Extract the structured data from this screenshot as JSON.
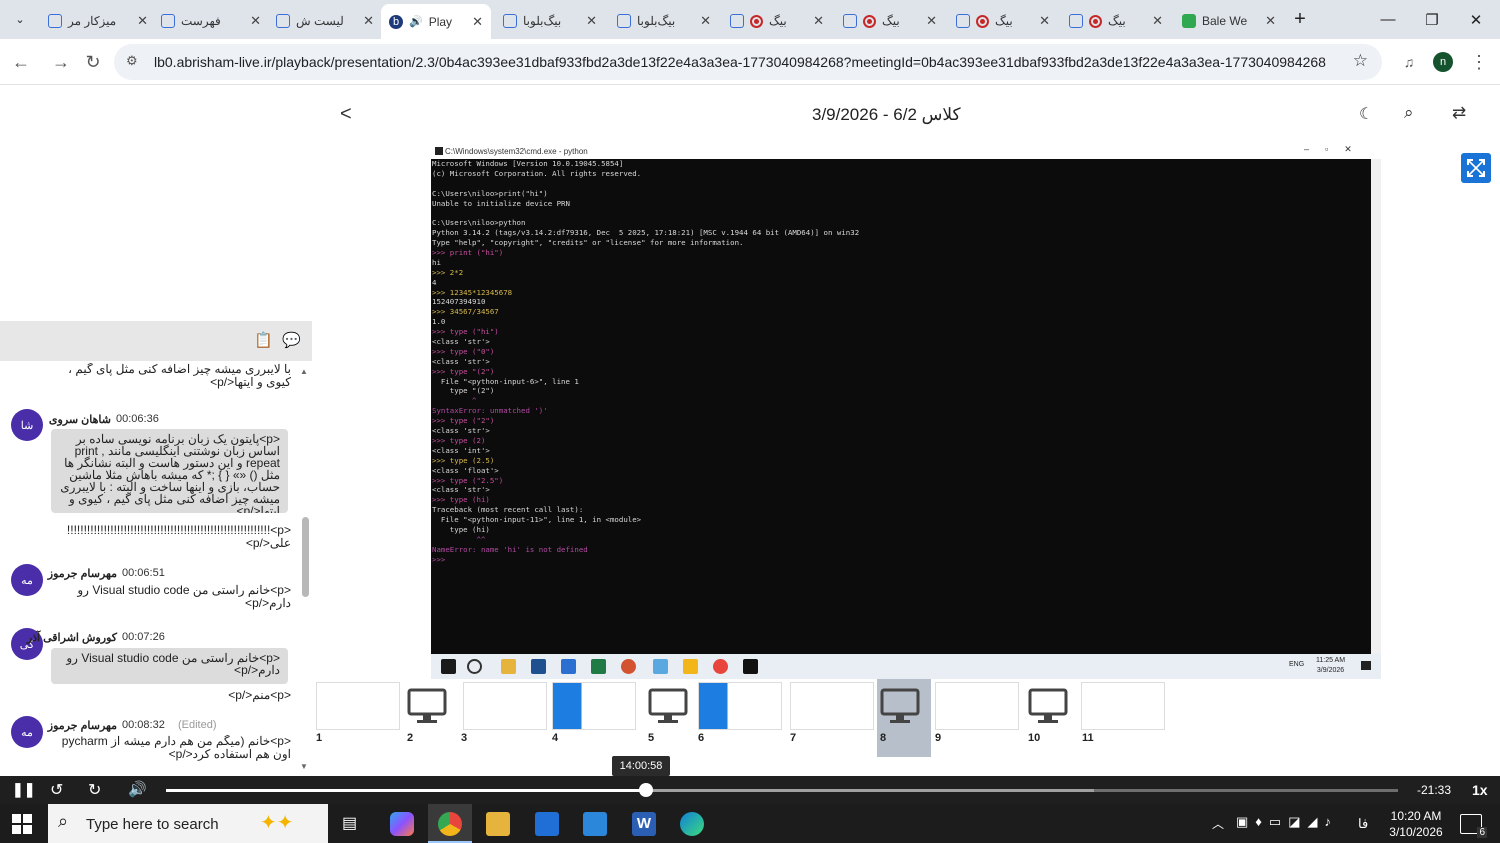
{
  "browser": {
    "tabs": [
      {
        "label": "میزکار مر",
        "icon": "bale-icon"
      },
      {
        "label": "فهرست",
        "icon": "bale-icon"
      },
      {
        "label": "لیست ش",
        "icon": "bale-icon"
      },
      {
        "label": "Play",
        "icon": "bigbluebutton-icon",
        "active": true
      },
      {
        "label": "بیگ‌بلوبا",
        "icon": "bale-icon"
      },
      {
        "label": "بیگ‌بلوبا",
        "icon": "bale-icon"
      },
      {
        "label": "بیگ",
        "icon": "bale-icon"
      },
      {
        "label": "بیگ",
        "icon": "bale-icon"
      },
      {
        "label": "بیگ",
        "icon": "bale-icon"
      },
      {
        "label": "بیگ",
        "icon": "bale-icon"
      },
      {
        "label": "Bale We",
        "icon": "bale-shield-icon"
      }
    ],
    "new_tab": "+",
    "url": "lb0.abrisham-live.ir/playback/presentation/2.3/0b4ac393ee31dbaf933fbd2a3de13f22e4a3a3ea-1773040984268?meetingId=0b4ac393ee31dbaf933fbd2a3de13f22e4a3a3ea-1773040984268",
    "profile_initial": "n"
  },
  "player": {
    "title": "کلاس 6/2 - 3/9/2026",
    "back": "<",
    "cmd_window_title": "C:\\Windows\\system32\\cmd.exe - python",
    "cmd_lines": [
      {
        "t": "Microsoft Windows [Version 10.0.19045.5854]",
        "c": ""
      },
      {
        "t": "(c) Microsoft Corporation. All rights reserved.",
        "c": ""
      },
      {
        "t": "",
        "c": ""
      },
      {
        "t": "C:\\Users\\niloo>print(\"hi\")",
        "c": ""
      },
      {
        "t": "Unable to initialize device PRN",
        "c": ""
      },
      {
        "t": "",
        "c": ""
      },
      {
        "t": "C:\\Users\\niloo>python",
        "c": ""
      },
      {
        "t": "Python 3.14.2 (tags/v3.14.2:df79316, Dec  5 2025, 17:18:21) [MSC v.1944 64 bit (AMD64)] on win32",
        "c": ""
      },
      {
        "t": "Type \"help\", \"copyright\", \"credits\" or \"license\" for more information.",
        "c": ""
      },
      {
        "t": ">>> print (\"hi\")",
        "c": "p"
      },
      {
        "t": "hi",
        "c": ""
      },
      {
        "t": ">>> 2*2",
        "c": "y"
      },
      {
        "t": "4",
        "c": ""
      },
      {
        "t": ">>> 12345*12345678",
        "c": "y"
      },
      {
        "t": "152407394910",
        "c": ""
      },
      {
        "t": ">>> 34567/34567",
        "c": "y"
      },
      {
        "t": "1.0",
        "c": ""
      },
      {
        "t": ">>> type (\"hi\")",
        "c": "p"
      },
      {
        "t": "<class 'str'>",
        "c": ""
      },
      {
        "t": ">>> type (\"0\")",
        "c": "p"
      },
      {
        "t": "<class 'str'>",
        "c": ""
      },
      {
        "t": ">>> type \"(2\")",
        "c": "p"
      },
      {
        "t": "  File \"<python-input-6>\", line 1",
        "c": ""
      },
      {
        "t": "    type \"(2\")",
        "c": ""
      },
      {
        "t": "         ^",
        "c": "e"
      },
      {
        "t": "SyntaxError: unmatched ')'",
        "c": "e"
      },
      {
        "t": ">>> type (\"2\")",
        "c": "p"
      },
      {
        "t": "<class 'str'>",
        "c": ""
      },
      {
        "t": ">>> type (2)",
        "c": "p"
      },
      {
        "t": "<class 'int'>",
        "c": ""
      },
      {
        "t": ">>> type (2.5)",
        "c": "y"
      },
      {
        "t": "<class 'float'>",
        "c": ""
      },
      {
        "t": ">>> type (\"2.5\")",
        "c": "p"
      },
      {
        "t": "<class 'str'>",
        "c": ""
      },
      {
        "t": ">>> type (hi)",
        "c": "p"
      },
      {
        "t": "Traceback (most recent call last):",
        "c": ""
      },
      {
        "t": "  File \"<python-input-11>\", line 1, in <module>",
        "c": ""
      },
      {
        "t": "    type (hi)",
        "c": ""
      },
      {
        "t": "          ^^",
        "c": "e"
      },
      {
        "t": "NameError: name 'hi' is not defined",
        "c": "e"
      },
      {
        "t": ">>>",
        "c": "e"
      }
    ],
    "inner_clock": "11:25 AM",
    "inner_date": "3/9/2026",
    "inner_lang": "ENG",
    "thumbnails": [
      {
        "n": "1",
        "kind": "doc"
      },
      {
        "n": "2",
        "kind": "screen"
      },
      {
        "n": "3",
        "kind": "doc"
      },
      {
        "n": "4",
        "kind": "blue"
      },
      {
        "n": "5",
        "kind": "screen"
      },
      {
        "n": "6",
        "kind": "blue"
      },
      {
        "n": "7",
        "kind": "blank"
      },
      {
        "n": "8",
        "kind": "screen",
        "selected": true
      },
      {
        "n": "9",
        "kind": "blank"
      },
      {
        "n": "10",
        "kind": "screen"
      },
      {
        "n": "11",
        "kind": "blank"
      }
    ]
  },
  "chat": {
    "messages": [
      {
        "type": "plain",
        "text": "با لایبرری میشه چیز اضافه کنی مثل پای گیم ، کیوی و ایتها</p>"
      },
      {
        "type": "msg",
        "avatar": "شا",
        "name": "شاهان سروی",
        "time": "00:06:36",
        "bubble": "<p>پایتون یک زبان برنامه نویسی ساده بر اساس زبان نوشتنی اینگلیسی مانند print , repeat و این دستور هاست و البته نشانگر ها مثل () «» { } ;* که میشه باهاش مثلا ماشین حساب، بازی و اینها ساخت و البته : با لایبرری میشه چیز اضافه کنی مثل پای گیم ، کیوی و ایتها</p>",
        "after": "<p>!!!!!!!!!!!!!!!!!!!!!!!!!!!!!!!!!!!!!!!!!!!!!!!!!!!!!!!!!!!!! علی</p>"
      },
      {
        "type": "msg",
        "avatar": "مه",
        "name": "مهرسام جرموز",
        "time": "00:06:51",
        "plain": "<p>خانم راستی من Visual studio code رو دارم</p>"
      },
      {
        "type": "msg",
        "avatar": "کی",
        "name": "کوروش اشراقی آذر",
        "time": "00:07:26",
        "bubble": "<p>خانم راستی من Visual studio code رو دارم</p>",
        "after": "<p>منم</p>"
      },
      {
        "type": "msg",
        "avatar": "مه",
        "name": "مهرسام جرموز",
        "time": "00:08:32",
        "edited": "(Edited)",
        "plain": "<p>خانم (میگم من هم دارم میشه از pycharm اون هم استفاده کرد</p>"
      }
    ]
  },
  "timeline": {
    "tooltip": "14:00:58",
    "remaining": "-21:33",
    "speed": "1x",
    "progress": 0.39,
    "buffered": 0.753
  },
  "taskbar": {
    "search_placeholder": "Type here to search",
    "time": "10:20 AM",
    "date": "3/10/2026",
    "lang": "فا",
    "notifications": "6"
  }
}
